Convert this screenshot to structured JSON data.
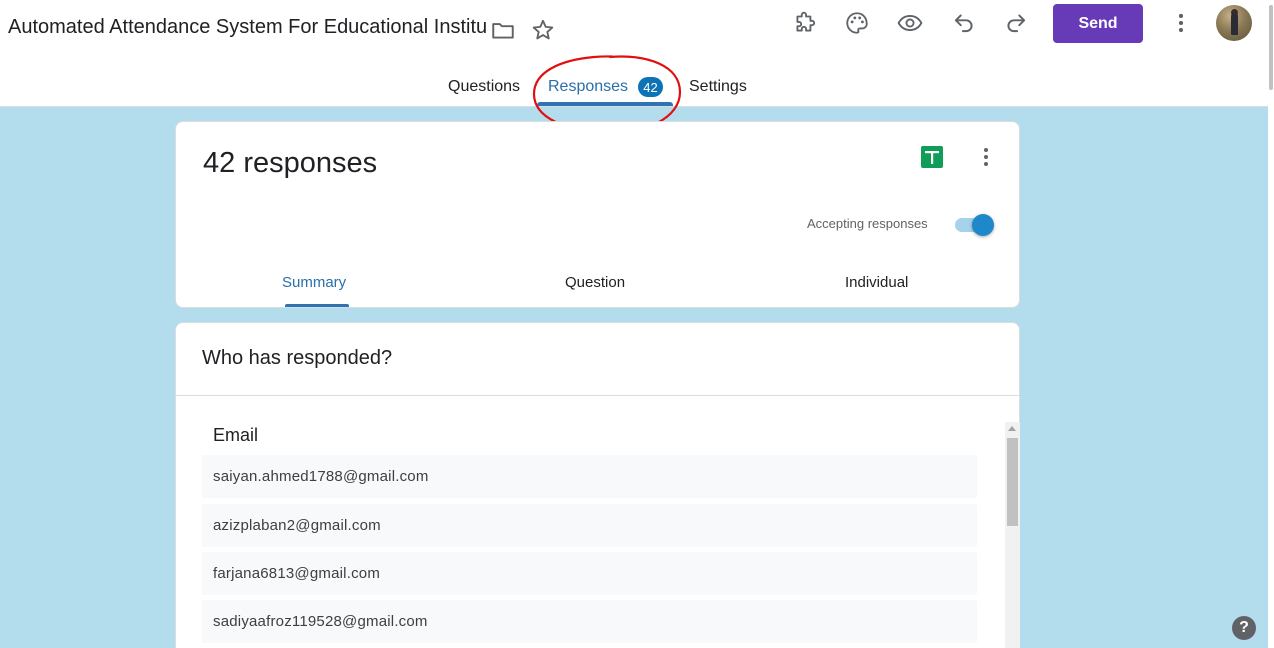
{
  "header": {
    "title": "Automated Attendance System For Educational Institu",
    "send_label": "Send",
    "icons": [
      "folder-icon",
      "star-icon",
      "addon-puzzle-icon",
      "palette-icon",
      "preview-eye-icon",
      "undo-icon",
      "redo-icon",
      "more-vert-icon"
    ]
  },
  "main_tabs": [
    {
      "label": "Questions"
    },
    {
      "label": "Responses",
      "badge": "42",
      "active": true
    },
    {
      "label": "Settings"
    }
  ],
  "summary_card": {
    "title": "42 responses",
    "accepting_label": "Accepting responses",
    "accepting": true,
    "tabs": [
      {
        "label": "Summary",
        "active": true
      },
      {
        "label": "Question"
      },
      {
        "label": "Individual"
      }
    ]
  },
  "who_card": {
    "title": "Who has responded?",
    "column_header": "Email",
    "emails": [
      "saiyan.ahmed1788@gmail.com",
      "azizplaban2@gmail.com",
      "farjana6813@gmail.com",
      "sadiyaafroz119528@gmail.com"
    ]
  },
  "help_label": "?",
  "colors": {
    "brand": "#673ab7",
    "accent": "#2f73b3",
    "page_bg": "#b3dcec",
    "annotation_red": "#e01010"
  }
}
